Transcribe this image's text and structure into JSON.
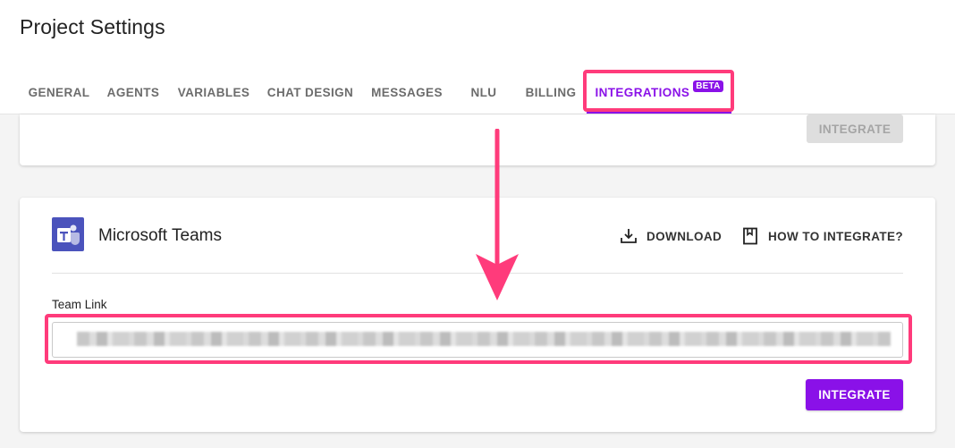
{
  "page": {
    "title": "Project Settings"
  },
  "tabs": [
    {
      "label": "GENERAL"
    },
    {
      "label": "AGENTS"
    },
    {
      "label": "VARIABLES"
    },
    {
      "label": "CHAT DESIGN"
    },
    {
      "label": "MESSAGES"
    },
    {
      "label": "NLU"
    },
    {
      "label": "BILLING"
    },
    {
      "label": "INTEGRATIONS",
      "badge": "BETA",
      "active": true
    }
  ],
  "top_card": {
    "button_label": "INTEGRATE",
    "button_state": "disabled"
  },
  "teams_card": {
    "title": "Microsoft Teams",
    "logo_icon": "microsoft-teams-icon",
    "actions": [
      {
        "label": "DOWNLOAD",
        "icon": "download-icon"
      },
      {
        "label": "HOW TO INTEGRATE?",
        "icon": "book-icon"
      }
    ],
    "field": {
      "label": "Team Link",
      "value": ""
    },
    "button_label": "INTEGRATE"
  },
  "colors": {
    "accent": "#8a11e8",
    "highlight": "#ff3b7b",
    "teams_brand": "#4b53bc",
    "disabled_bg": "#dedede"
  }
}
